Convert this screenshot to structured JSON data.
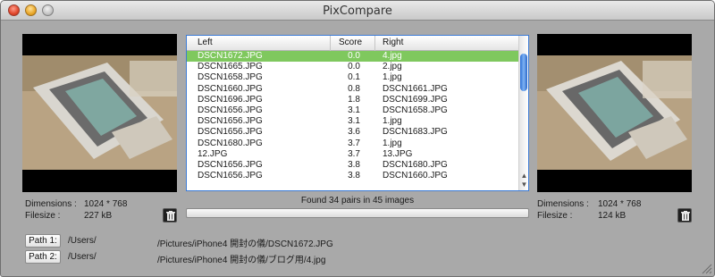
{
  "window": {
    "title": "PixCompare"
  },
  "list": {
    "headers": {
      "left": "Left",
      "score": "Score",
      "right": "Right"
    },
    "rows": [
      {
        "left": "DSCN1672.JPG",
        "score": "0.0",
        "right": "4.jpg",
        "selected": true
      },
      {
        "left": "DSCN1665.JPG",
        "score": "0.0",
        "right": "2.jpg"
      },
      {
        "left": "DSCN1658.JPG",
        "score": "0.1",
        "right": "1.jpg"
      },
      {
        "left": "DSCN1660.JPG",
        "score": "0.8",
        "right": "DSCN1661.JPG"
      },
      {
        "left": "DSCN1696.JPG",
        "score": "1.8",
        "right": "DSCN1699.JPG"
      },
      {
        "left": "DSCN1656.JPG",
        "score": "3.1",
        "right": "DSCN1658.JPG"
      },
      {
        "left": "DSCN1656.JPG",
        "score": "3.1",
        "right": "1.jpg"
      },
      {
        "left": "DSCN1656.JPG",
        "score": "3.6",
        "right": "DSCN1683.JPG"
      },
      {
        "left": "DSCN1680.JPG",
        "score": "3.7",
        "right": "1.jpg"
      },
      {
        "left": "12.JPG",
        "score": "3.7",
        "right": "13.JPG"
      },
      {
        "left": "DSCN1656.JPG",
        "score": "3.8",
        "right": "DSCN1680.JPG"
      },
      {
        "left": "DSCN1656.JPG",
        "score": "3.8",
        "right": "DSCN1660.JPG"
      }
    ]
  },
  "status": {
    "found_text": "Found 34 pairs in 45 images",
    "progress": 0
  },
  "left_info": {
    "dimensions_label": "Dimensions :",
    "dimensions_value": "1024 * 768",
    "filesize_label": "Filesize :",
    "filesize_value": "227 kB"
  },
  "right_info": {
    "dimensions_label": "Dimensions :",
    "dimensions_value": "1024 * 768",
    "filesize_label": "Filesize :",
    "filesize_value": "124 kB"
  },
  "paths": {
    "path1_label": "Path 1:",
    "path1_user": "/Users/",
    "path1_rest": "/Pictures/iPhone4 開封の儀/DSCN1672.JPG",
    "path2_label": "Path 2:",
    "path2_user": "/Users/",
    "path2_rest": "/Pictures/iPhone4 開封の儀/ブログ用/4.jpg"
  },
  "icons": {
    "left_trash": "trash-icon",
    "right_trash": "trash-icon",
    "resize": "resize-grip-icon"
  },
  "colors": {
    "selection": "#7fc85e",
    "list_border": "#3b7ad4",
    "window_bg": "#a9a9a9"
  }
}
